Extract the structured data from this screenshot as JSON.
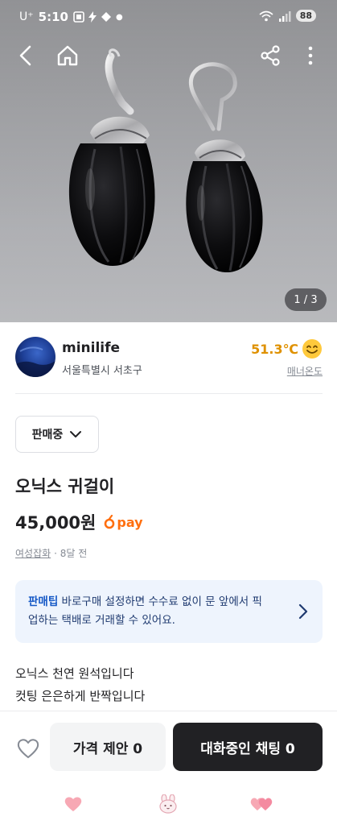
{
  "status_bar": {
    "carrier": "U⁺",
    "time": "5:10",
    "battery": "88"
  },
  "top_nav": {
    "back_icon": "back-arrow-icon",
    "home_icon": "home-icon",
    "share_icon": "share-icon",
    "more_icon": "more-vertical-icon"
  },
  "gallery": {
    "indicator": "1 / 3"
  },
  "seller": {
    "name": "minilife",
    "location": "서울특별시 서초구",
    "temperature": "51.3℃",
    "temperature_label": "매너온도"
  },
  "product": {
    "status": "판매중",
    "title": "오닉스 귀걸이",
    "price": "45,000원",
    "pay_label": "pay",
    "category": "여성잡화",
    "time_ago": "· 8달 전",
    "description": [
      "오닉스 천연 원석입니다",
      "컷팅 은은하게 반짝입니다"
    ]
  },
  "tip": {
    "strong": "판매팁",
    "text": " 바로구매 설정하면 수수료 없이 문 앞에서 픽업하는 택배로 거래할 수 있어요."
  },
  "bottom_bar": {
    "offer_label": "가격 제안 0",
    "chat_label": "대화중인 채팅 0"
  },
  "colors": {
    "brand": "#ff6f0f",
    "temperature": "#df9100",
    "tip_bg": "#eef4fd",
    "chat_button": "#212124"
  }
}
